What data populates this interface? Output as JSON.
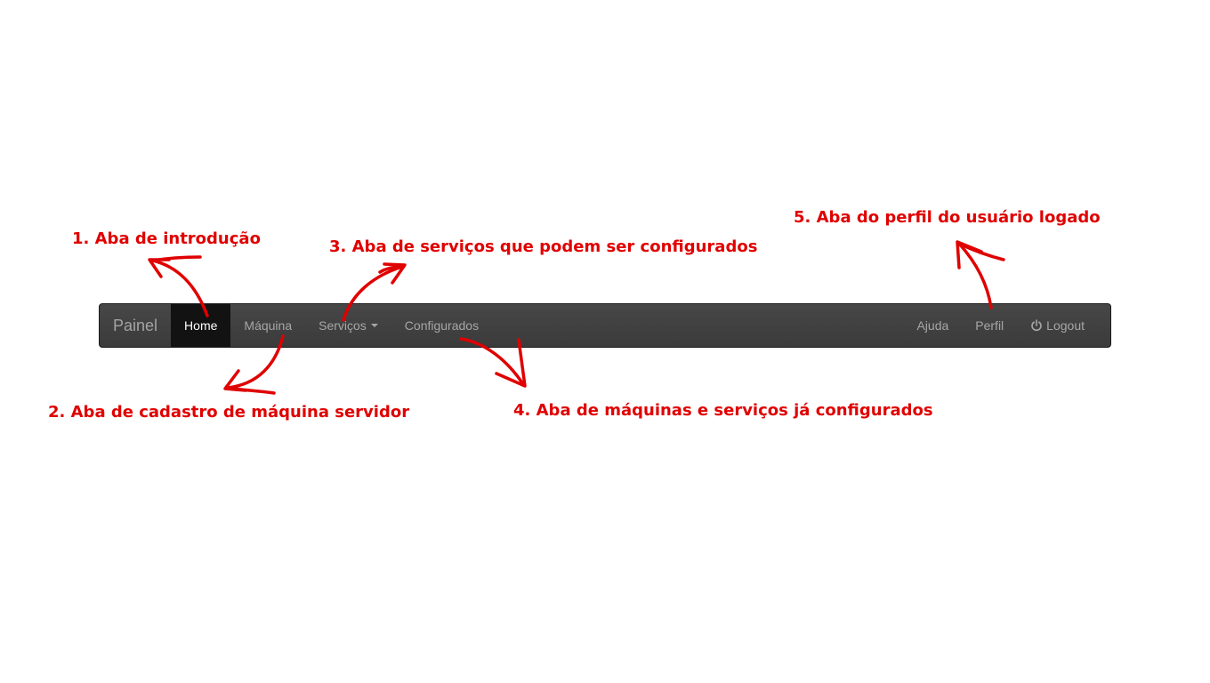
{
  "navbar": {
    "brand": "Painel",
    "left_items": [
      {
        "label": "Home",
        "active": true
      },
      {
        "label": "Máquina",
        "active": false
      },
      {
        "label": "Serviços",
        "active": false,
        "dropdown": true
      },
      {
        "label": "Configurados",
        "active": false
      }
    ],
    "right_items": [
      {
        "label": "Ajuda"
      },
      {
        "label": "Perfil"
      },
      {
        "label": "Logout",
        "icon": "power-icon"
      }
    ]
  },
  "annotations": [
    {
      "text": "1. Aba de introdução"
    },
    {
      "text": "2. Aba de cadastro de máquina servidor"
    },
    {
      "text": "3. Aba de serviços que podem ser configurados"
    },
    {
      "text": "4. Aba de máquinas e serviços já configurados"
    },
    {
      "text": "5. Aba do perfil do usuário logado"
    }
  ],
  "colors": {
    "annotation": "#e00000",
    "navbar_bg": "#3f3f3f",
    "active_tab_bg": "#121212"
  }
}
